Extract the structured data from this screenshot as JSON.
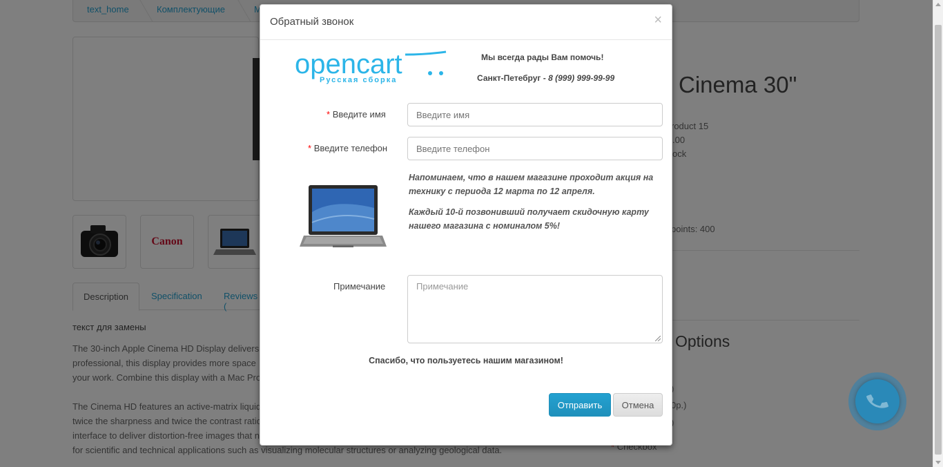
{
  "breadcrumb": [
    "text_home",
    "Комплектующие",
    "M"
  ],
  "thumbnails": {
    "canon_label": "Canon"
  },
  "tabs": [
    {
      "label": "Description"
    },
    {
      "label": "Specification"
    },
    {
      "label": "Reviews ("
    }
  ],
  "description": {
    "heading": "текст для замены",
    "lines": [
      "The 30-inch Apple Cinema HD Display delivers",
      "professional, this display provides more space",
      "your work. Combine this display with a Mac Pro",
      "The Cinema HD features an active-matrix liquid",
      "twice the sharpness and twice the contrast ratio",
      "interface to deliver distortion-free images that n",
      "for scientific and technical applications such as visualizing molecular structures or analyzing geological data."
    ]
  },
  "product": {
    "title_fragment": "Cinema 30\"",
    "info_lines": [
      "roduct 15",
      ".00",
      "ock"
    ],
    "points": "points: 400",
    "options_title": "Options",
    "option_fragments": [
      ")",
      "0р.)",
      ")"
    ],
    "checkbox_label": "Checkbox"
  },
  "modal": {
    "title": "Обратный звонок",
    "close_symbol": "×",
    "logo_text": "opencart",
    "logo_subtext": "Русская сборка",
    "help_title": "Мы всегда рады Вам помочь!",
    "help_city": "Санкт-Петебруг",
    "help_dash": "-",
    "help_phone": "8 (999) 999-99-99",
    "required_mark": "*",
    "name_label": "Введите имя",
    "name_placeholder": "Введите имя",
    "phone_label": "Введите телефон",
    "phone_placeholder": "Введите телефон",
    "promo_1": "Напоминаем, что в нашем магазине проходит акция на технику с периода 12 марта по 12 апреля.",
    "promo_2": "Каждый 10-й позвонивший получает скидочную карту нашего магазина с номиналом 5%!",
    "note_label": "Примечание",
    "note_placeholder": "Примечание",
    "thanks": "Спасибо, что пользуетесь нашим магазином!",
    "submit_label": "Отправить",
    "cancel_label": "Отмена"
  },
  "colors": {
    "accent": "#23a1d1",
    "overlay": "rgba(0,0,0,0.5)",
    "required": "#ff0000"
  },
  "icons": [
    "close-icon",
    "phone-icon",
    "opencart-cart-icon",
    "laptop-image",
    "camera-image"
  ]
}
